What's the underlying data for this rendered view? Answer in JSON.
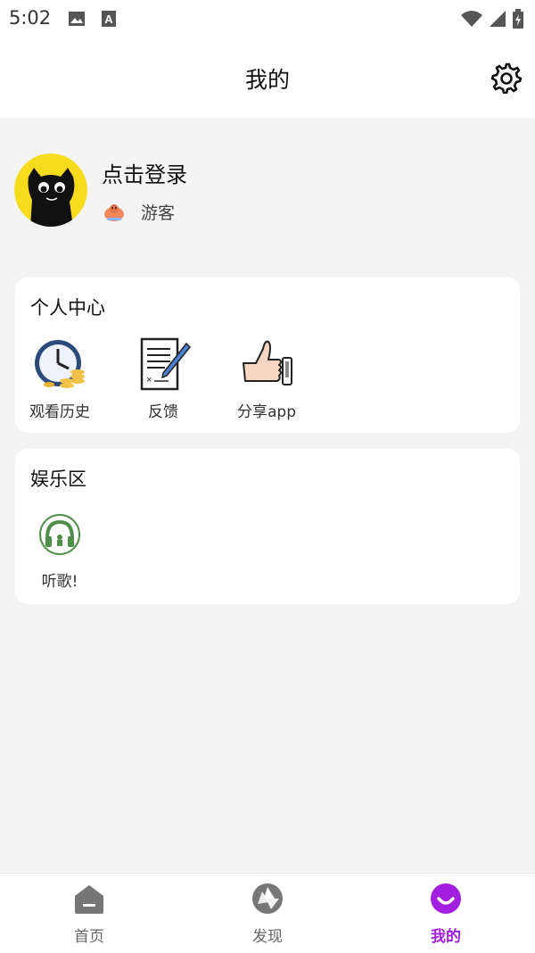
{
  "status_bar": {
    "time": "5:02",
    "icons": [
      "image-icon",
      "a-icon",
      "wifi-icon",
      "signal-icon",
      "battery-icon"
    ]
  },
  "header": {
    "title": "我的",
    "settings_icon": "gear-icon"
  },
  "profile": {
    "avatar_icon": "black-cat-avatar",
    "login_text": "点击登录",
    "guest_label": "游客",
    "guest_icon": "guest-badge-icon"
  },
  "personal_center": {
    "title": "个人中心",
    "items": [
      {
        "label": "观看历史",
        "icon": "clock-coins-icon"
      },
      {
        "label": "反馈",
        "icon": "document-pen-icon"
      },
      {
        "label": "分享app",
        "icon": "thumbs-up-icon"
      }
    ]
  },
  "entertainment": {
    "title": "娱乐区",
    "items": [
      {
        "label": "听歌!",
        "icon": "headphones-icon"
      }
    ]
  },
  "bottom_nav": {
    "items": [
      {
        "label": "首页",
        "icon": "home-icon",
        "active": false
      },
      {
        "label": "发现",
        "icon": "aperture-icon",
        "active": false
      },
      {
        "label": "我的",
        "icon": "smile-icon",
        "active": true
      }
    ],
    "active_color": "#a21fe0",
    "inactive_color": "#666666"
  }
}
